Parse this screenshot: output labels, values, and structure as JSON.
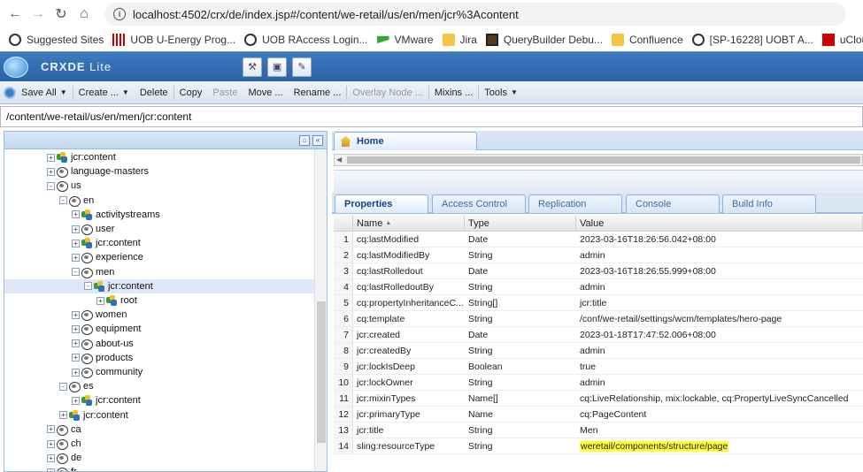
{
  "browser": {
    "url": "localhost:4502/crx/de/index.jsp#/content/we-retail/us/en/men/jcr%3Acontent",
    "bookmarks": [
      {
        "label": "Suggested Sites",
        "icon": "globe-icon"
      },
      {
        "label": "UOB U-Energy Prog...",
        "icon": "uob-icon"
      },
      {
        "label": "UOB RAccess Login...",
        "icon": "globe-icon"
      },
      {
        "label": "VMware",
        "icon": "vmware-icon"
      },
      {
        "label": "Jira",
        "icon": "folder-icon"
      },
      {
        "label": "QueryBuilder Debu...",
        "icon": "querybuilder-icon"
      },
      {
        "label": "Confluence",
        "icon": "folder-icon"
      },
      {
        "label": "[SP-16228] UOBT A...",
        "icon": "globe-icon"
      },
      {
        "label": "uCloud",
        "icon": "ucloud-icon"
      }
    ]
  },
  "app": {
    "title_main": "CRXDE",
    "title_sub": "Lite"
  },
  "toolbar": {
    "save_all": "Save All",
    "create": "Create ...",
    "delete": "Delete",
    "copy": "Copy",
    "paste": "Paste",
    "move": "Move ...",
    "rename": "Rename ...",
    "overlay_node": "Overlay Node ...",
    "mixins": "Mixins ...",
    "tools": "Tools"
  },
  "path": "/content/we-retail/us/en/men/jcr:content",
  "tree": [
    {
      "label": "jcr:content",
      "icon": "page",
      "depth": 3,
      "sign": "+"
    },
    {
      "label": "language-masters",
      "icon": "folder",
      "depth": 3,
      "sign": "+"
    },
    {
      "label": "us",
      "icon": "folder",
      "depth": 3,
      "sign": "-"
    },
    {
      "label": "en",
      "icon": "folder",
      "depth": 4,
      "sign": "-"
    },
    {
      "label": "activitystreams",
      "icon": "page",
      "depth": 5,
      "sign": "+"
    },
    {
      "label": "user",
      "icon": "folder",
      "depth": 5,
      "sign": "+"
    },
    {
      "label": "jcr:content",
      "icon": "page",
      "depth": 5,
      "sign": "+"
    },
    {
      "label": "experience",
      "icon": "folder",
      "depth": 5,
      "sign": "+"
    },
    {
      "label": "men",
      "icon": "folder",
      "depth": 5,
      "sign": "-"
    },
    {
      "label": "jcr:content",
      "icon": "page",
      "depth": 6,
      "sign": "-",
      "selected": true
    },
    {
      "label": "root",
      "icon": "page",
      "depth": 7,
      "sign": "+"
    },
    {
      "label": "women",
      "icon": "folder",
      "depth": 5,
      "sign": "+"
    },
    {
      "label": "equipment",
      "icon": "folder",
      "depth": 5,
      "sign": "+"
    },
    {
      "label": "about-us",
      "icon": "folder",
      "depth": 5,
      "sign": "+"
    },
    {
      "label": "products",
      "icon": "folder",
      "depth": 5,
      "sign": "+"
    },
    {
      "label": "community",
      "icon": "folder",
      "depth": 5,
      "sign": "+"
    },
    {
      "label": "es",
      "icon": "folder",
      "depth": 4,
      "sign": "-"
    },
    {
      "label": "jcr:content",
      "icon": "page",
      "depth": 5,
      "sign": "+"
    },
    {
      "label": "jcr:content",
      "icon": "page",
      "depth": 4,
      "sign": "+"
    },
    {
      "label": "ca",
      "icon": "folder",
      "depth": 3,
      "sign": "+"
    },
    {
      "label": "ch",
      "icon": "folder",
      "depth": 3,
      "sign": "+"
    },
    {
      "label": "de",
      "icon": "folder",
      "depth": 3,
      "sign": "+"
    },
    {
      "label": "fr",
      "icon": "folder",
      "depth": 3,
      "sign": "+"
    }
  ],
  "home_tab": "Home",
  "prop_tabs": [
    "Properties",
    "Access Control",
    "Replication",
    "Console",
    "Build Info"
  ],
  "grid": {
    "headers": [
      "Name",
      "Type",
      "Value"
    ],
    "sort_indicator": "▲",
    "rows": [
      [
        "1",
        "cq:lastModified",
        "Date",
        "2023-03-16T18:26:56.042+08:00"
      ],
      [
        "2",
        "cq:lastModifiedBy",
        "String",
        "admin"
      ],
      [
        "3",
        "cq:lastRolledout",
        "Date",
        "2023-03-16T18:26:55.999+08:00"
      ],
      [
        "4",
        "cq:lastRolledoutBy",
        "String",
        "admin"
      ],
      [
        "5",
        "cq:propertyInheritanceC...",
        "String[]",
        "jcr:title"
      ],
      [
        "6",
        "cq:template",
        "String",
        "/conf/we-retail/settings/wcm/templates/hero-page"
      ],
      [
        "7",
        "jcr:created",
        "Date",
        "2023-01-18T17:47:52.006+08:00"
      ],
      [
        "8",
        "jcr:createdBy",
        "String",
        "admin"
      ],
      [
        "9",
        "jcr:lockIsDeep",
        "Boolean",
        "true"
      ],
      [
        "10",
        "jcr:lockOwner",
        "String",
        "admin"
      ],
      [
        "11",
        "jcr:mixinTypes",
        "Name[]",
        "cq:LiveRelationship, mix:lockable, cq:PropertyLiveSyncCancelled"
      ],
      [
        "12",
        "jcr:primaryType",
        "Name",
        "cq:PageContent"
      ],
      [
        "13",
        "jcr:title",
        "String",
        "Men"
      ],
      [
        "14",
        "sling:resourceType",
        "String",
        "weretail/components/structure/page"
      ]
    ],
    "highlighted_row": 13
  }
}
